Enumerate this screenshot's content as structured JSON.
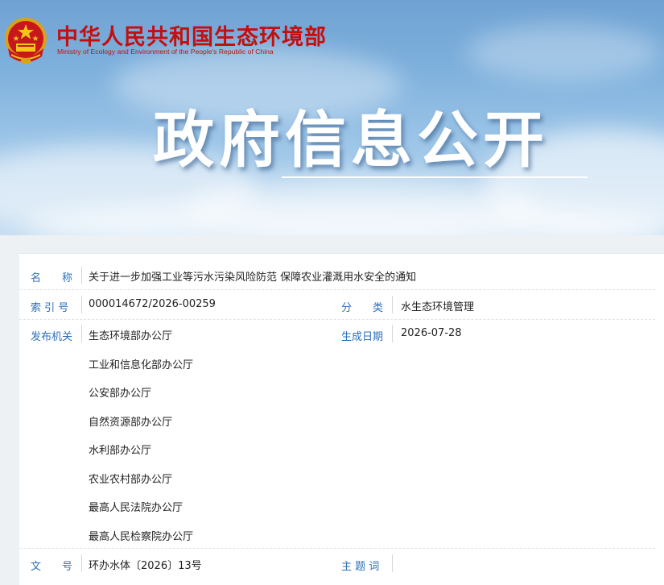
{
  "header": {
    "ministry_name_cn": "中华人民共和国生态环境部",
    "ministry_name_en": "Ministry of Ecology and Environment of the People's Republic of China",
    "banner_title": "政府信息公开"
  },
  "document": {
    "name_label": "名　　称",
    "name_value": "关于进一步加强工业等污水污染风险防范 保障农业灌溉用水安全的通知",
    "index_label": "索 引 号",
    "index_value": "000014672/2026-00259",
    "category_label": "分　　类",
    "category_value": "水生态环境管理",
    "issuer_label": "发布机关",
    "issuers": [
      "生态环境部办公厅",
      "工业和信息化部办公厅",
      "公安部办公厅",
      "自然资源部办公厅",
      "水利部办公厅",
      "农业农村部办公厅",
      "最高人民法院办公厅",
      "最高人民检察院办公厅"
    ],
    "date_label": "生成日期",
    "date_value": "2026-07-28",
    "docno_label": "文　　号",
    "docno_value": "环办水体〔2026〕13号",
    "keywords_label": "主 题 词",
    "keywords_value": ""
  },
  "colors": {
    "ministry_red": "#c40f0f",
    "label_blue": "#2d6fb9",
    "banner_sky": "#7fb1dd"
  },
  "icons": {
    "emblem": "national-emblem-icon"
  }
}
